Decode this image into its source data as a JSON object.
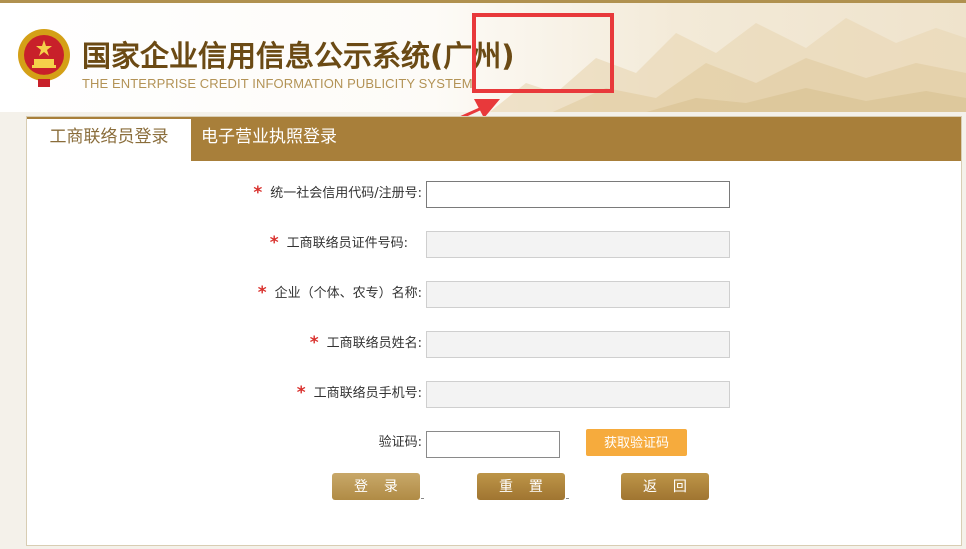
{
  "header": {
    "title": "国家企业信用信息公示系统(广州)",
    "subtitle": "THE ENTERPRISE CREDIT INFORMATION PUBLICITY SYSTEM",
    "emblem_icon": "national-emblem-icon"
  },
  "annotation": {
    "color": "#e8393b"
  },
  "tabs": [
    {
      "label": "工商联络员登录",
      "active": true
    },
    {
      "label": "电子营业执照登录",
      "active": false
    }
  ],
  "form": {
    "required_mark": "*",
    "fields": [
      {
        "label": "统一社会信用代码/注册号:",
        "value": "",
        "required": true
      },
      {
        "label": "工商联络员证件号码:",
        "value": "",
        "required": true
      },
      {
        "label": "企业（个体、农专）名称:",
        "value": "",
        "required": true
      },
      {
        "label": "工商联络员姓名:",
        "value": "",
        "required": true
      },
      {
        "label": "工商联络员手机号:",
        "value": "",
        "required": true
      }
    ],
    "captcha": {
      "label": "验证码:",
      "value": "",
      "button": "获取验证码"
    },
    "buttons": {
      "login": "登 录",
      "reset": "重 置",
      "back": "返 回"
    }
  },
  "colors": {
    "brand_gold": "#a87f3a",
    "title_brown": "#6b4a14",
    "required_red": "#d9302c",
    "captcha_orange": "#f6ab3d"
  }
}
